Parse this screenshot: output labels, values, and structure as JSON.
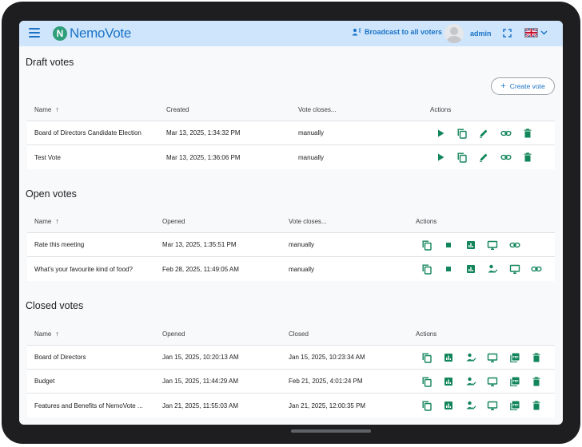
{
  "header": {
    "logo_text": "NemoVote",
    "broadcast_label": "Broadcast to all voters",
    "user_label": "admin",
    "language_flag": "uk-flag-icon"
  },
  "colors": {
    "accent": "#1a73c7",
    "icon_green": "#12855b",
    "header_bg": "#cfe5fb",
    "logo_mark": "#2f9e7a"
  },
  "draft": {
    "title": "Draft votes",
    "create_label": "Create vote",
    "columns": {
      "name": "Name",
      "created": "Created",
      "closes": "Vote closes...",
      "actions": "Actions"
    },
    "rows": [
      {
        "name": "Board of Directors Candidate Election",
        "created": "Mar 13, 2025, 1:34:32 PM",
        "closes": "manually",
        "actions": [
          "play-icon",
          "copy-icon",
          "edit-icon",
          "link-icon",
          "delete-icon"
        ]
      },
      {
        "name": "Test Vote",
        "created": "Mar 13, 2025, 1:36:06 PM",
        "closes": "manually",
        "actions": [
          "play-icon",
          "copy-icon",
          "edit-icon",
          "link-icon",
          "delete-icon"
        ]
      }
    ]
  },
  "open": {
    "title": "Open votes",
    "columns": {
      "name": "Name",
      "opened": "Opened",
      "closes": "Vote closes...",
      "actions": "Actions"
    },
    "rows": [
      {
        "name": "Rate this meeting",
        "opened": "Mar 13, 2025, 1:35:51 PM",
        "closes": "manually",
        "actions": [
          "copy-icon",
          "stop-icon",
          "bar-chart-icon",
          "monitor-icon",
          "link-icon"
        ]
      },
      {
        "name": "What's your favourite kind of food?",
        "opened": "Feb 28, 2025, 11:49:05 AM",
        "closes": "manually",
        "actions": [
          "copy-icon",
          "stop-icon",
          "bar-chart-icon",
          "voter-check-icon",
          "monitor-icon",
          "link-icon"
        ]
      }
    ]
  },
  "closed": {
    "title": "Closed votes",
    "columns": {
      "name": "Name",
      "opened": "Opened",
      "closed": "Closed",
      "actions": "Actions"
    },
    "rows": [
      {
        "name": "Board of Directors",
        "opened": "Jan 15, 2025, 10:20:13 AM",
        "closed": "Jan 15, 2025, 10:23:34 AM",
        "actions": [
          "copy-icon",
          "bar-chart-icon",
          "voter-check-icon",
          "monitor-icon",
          "pdf-icon",
          "delete-icon"
        ]
      },
      {
        "name": "Budget",
        "opened": "Jan 15, 2025, 11:44:29 AM",
        "closed": "Feb 21, 2025, 4:01:24 PM",
        "actions": [
          "copy-icon",
          "bar-chart-icon",
          "voter-check-icon",
          "monitor-icon",
          "pdf-icon",
          "delete-icon"
        ]
      },
      {
        "name": "Features and Benefits of NemoVote ...",
        "opened": "Jan 21, 2025, 11:55:03 AM",
        "closed": "Jan 21, 2025, 12:00:35 PM",
        "actions": [
          "copy-icon",
          "bar-chart-icon",
          "voter-check-icon",
          "monitor-icon",
          "pdf-icon",
          "delete-icon"
        ]
      }
    ]
  }
}
